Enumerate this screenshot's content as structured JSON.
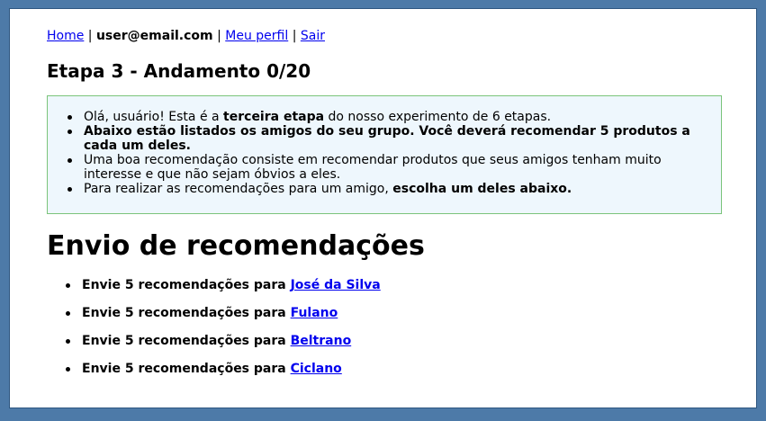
{
  "nav": {
    "home": "Home",
    "sep1": "|",
    "user": "user@email.com",
    "sep2": "|",
    "profile": "Meu perfil",
    "sep3": "|",
    "logout": "Sair"
  },
  "stage_title": "Etapa 3 - Andamento 0/20",
  "info": {
    "item1": {
      "a": "Olá, usuário! Esta é a ",
      "b": "terceira etapa",
      "c": " do nosso experimento de 6 etapas."
    },
    "item2": "Abaixo estão listados os amigos do seu grupo. Você deverá recomendar 5 produtos a cada um deles.",
    "item3": "Uma boa recomendação consiste em recomendar produtos que seus amigos tenham muito interesse e que não sejam óbvios a eles.",
    "item4": {
      "a": "Para realizar as recomendações para um amigo, ",
      "b": "escolha um deles abaixo."
    }
  },
  "section_title": "Envio de recomendações",
  "recommendations": {
    "prefix": "Envie 5 recomendações para ",
    "friends": [
      "José da Silva",
      "Fulano",
      "Beltrano",
      "Ciclano"
    ]
  }
}
